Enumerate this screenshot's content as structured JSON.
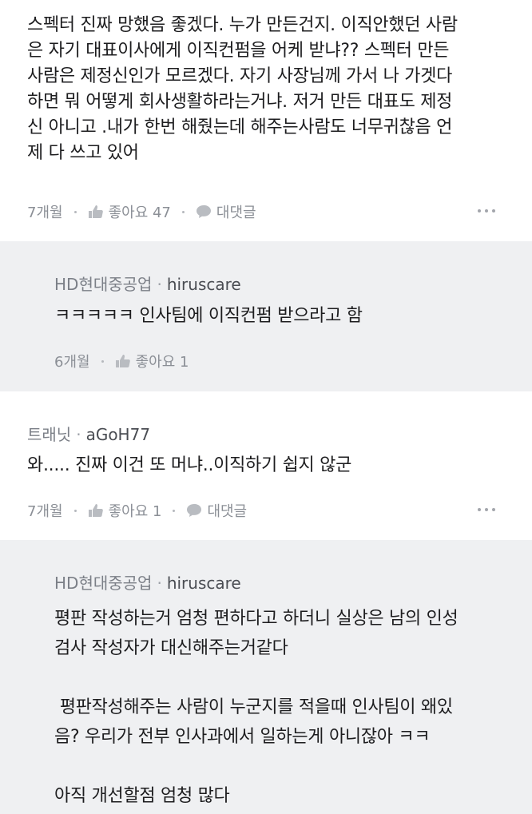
{
  "comments": [
    {
      "lines": [
        "스펙터 진짜 망했음 좋겠다. 누가 만든건지. 이직안했던 사람",
        "은 자기 대표이사에게 이직컨펌을 어케 받냐?? 스펙터 만든",
        "사람은 제정신인가 모르겠다. 자기 사장님께 가서 나 가겟다",
        "하면 뭐 어떻게 회사생활하라는거냐. 저거 만든 대표도 제정",
        "신 아니고 .내가 한번 해줬는데 해주는사람도 너무귀찮음 언",
        "제 다 쓰고 있어"
      ],
      "time": "7개월",
      "like_label": "좋아요 47",
      "reply_label": "대댓글"
    },
    {
      "company": "HD현대중공업",
      "user": "hiruscare",
      "lines": [
        "ㅋㅋㅋㅋㅋ 인사팀에 이직컨펌 받으라고 함"
      ],
      "time": "6개월",
      "like_label": "좋아요 1"
    },
    {
      "company": "트래닛",
      "user": "aGoH77",
      "lines": [
        "와..... 진짜 이건 또 머냐..이직하기 쉽지 않군"
      ],
      "time": "7개월",
      "like_label": "좋아요 1",
      "reply_label": "대댓글"
    },
    {
      "company": "HD현대중공업",
      "user": "hiruscare",
      "lines": [
        "평판 작성하는거 엄청 편하다고 하더니 실상은 남의 인성",
        "검사 작성자가 대신해주는거같다",
        "",
        " 평판작성해주는 사람이 누군지를 적을때 인사팀이 왜있",
        "음? 우리가 전부 인사과에서 일하는게 아니잖아 ㅋㅋ",
        "",
        "아직 개선할점 엄청 많다"
      ]
    }
  ],
  "icons": {
    "like": "thumbs-up-icon",
    "reply": "speech-bubble-icon",
    "more": "more-horizontal-icon"
  },
  "colors": {
    "reply_background": "#eff0f2",
    "meta_text": "#7b7f87"
  }
}
